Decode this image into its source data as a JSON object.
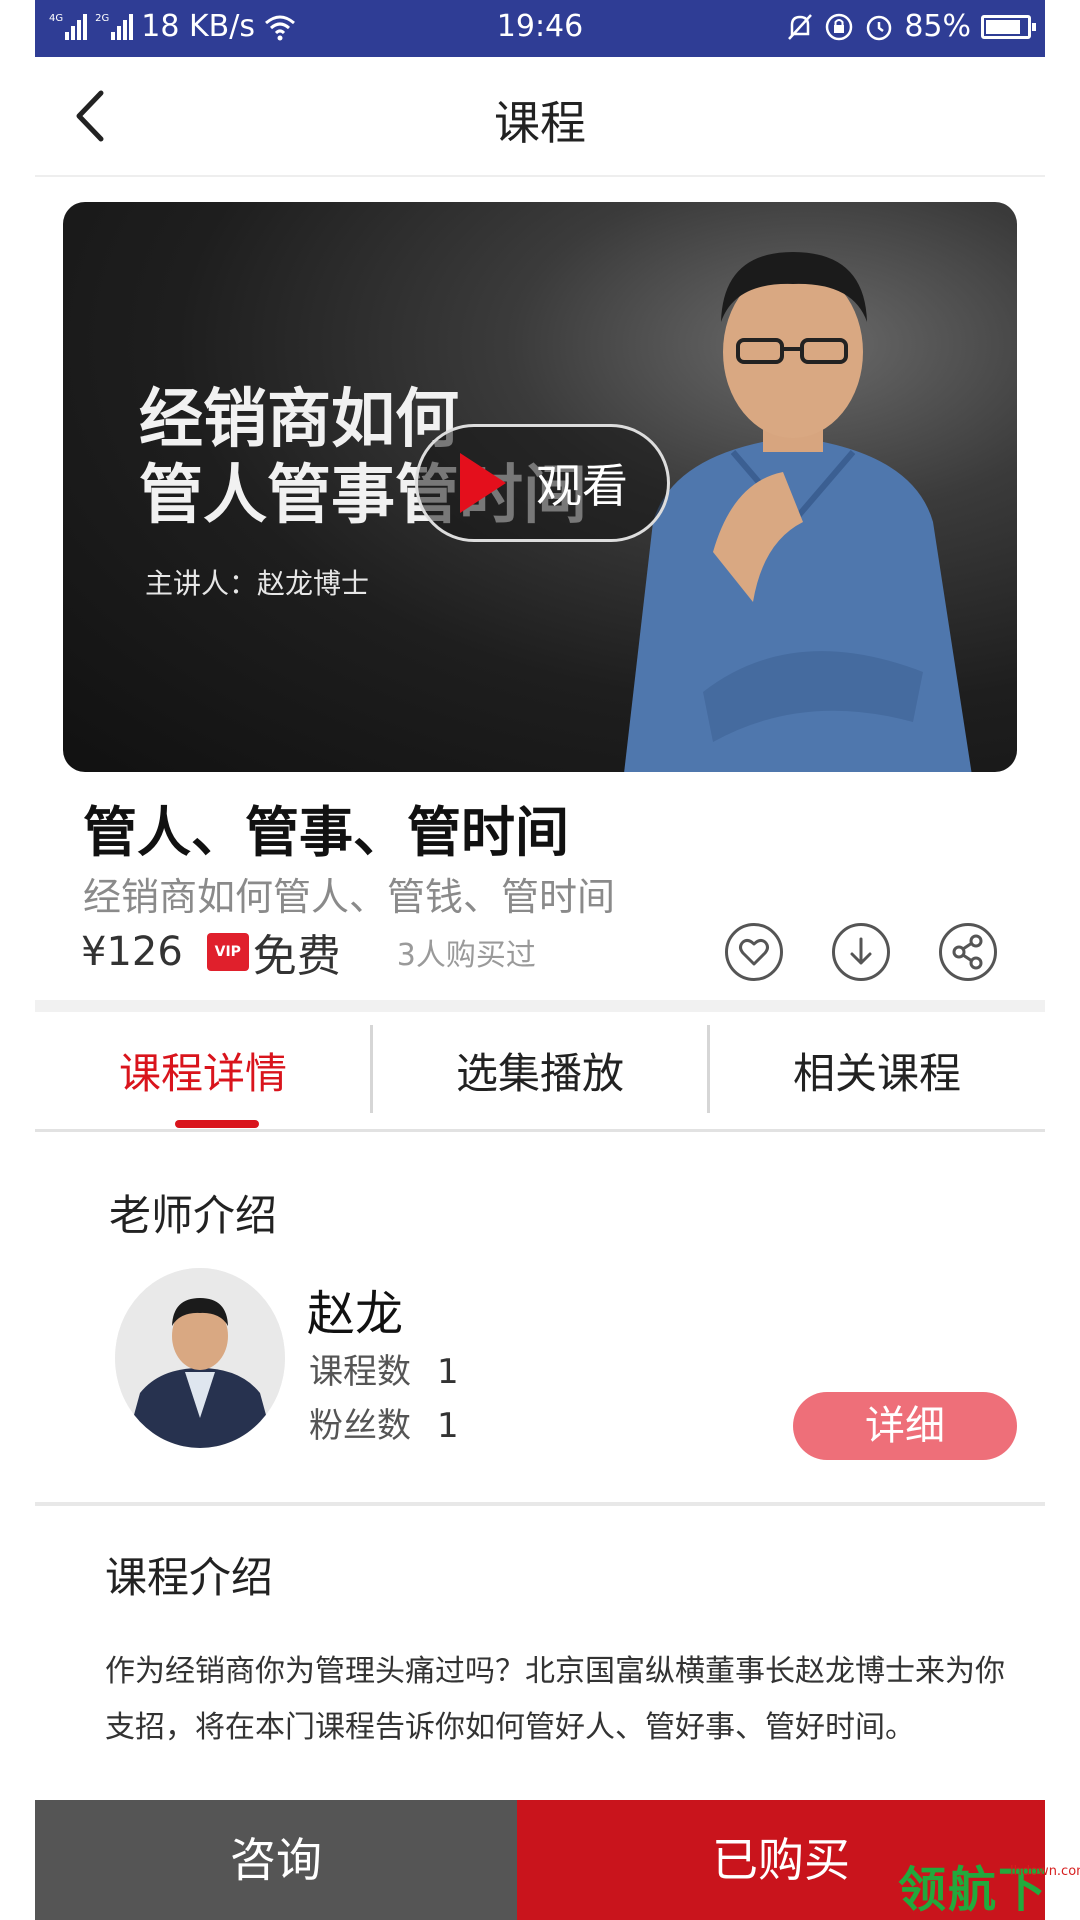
{
  "status_bar": {
    "network_speed": "18 KB/s",
    "time": "19:46",
    "battery": "85%",
    "battery_level": 0.85,
    "icons": [
      "signal-4g-icon",
      "signal-2g-icon",
      "wifi-icon",
      "mute-icon",
      "rotation-lock-icon",
      "alarm-icon",
      "battery-icon"
    ]
  },
  "header": {
    "title": "课程"
  },
  "hero": {
    "title_lines": [
      "经销商如何",
      "管人管事管时间"
    ],
    "speaker": "主讲人：赵龙博士",
    "watch_label": "观看"
  },
  "course": {
    "title": "管人、管事、管时间",
    "subtitle": "经销商如何管人、管钱、管时间",
    "price": "¥126",
    "vip_badge": "VIP",
    "vip_price": "免费",
    "buyers": "3人购买过"
  },
  "tabs": [
    {
      "label": "课程详情",
      "active": true
    },
    {
      "label": "选集播放",
      "active": false
    },
    {
      "label": "相关课程",
      "active": false
    }
  ],
  "teacher": {
    "heading": "老师介绍",
    "name": "赵龙",
    "courses_label": "课程数",
    "courses_value": "1",
    "fans_label": "粉丝数",
    "fans_value": "1",
    "detail_button": "详细"
  },
  "intro": {
    "heading": "课程介绍",
    "text": "作为经销商你为管理头痛过吗？北京国富纵横董事长赵龙博士来为你支招，将在本门课程告诉你如何管好人、管好事、管好时间。"
  },
  "bottom_bar": {
    "consult": "咨询",
    "bought": "已购买"
  },
  "watermark": {
    "brand": "领航下载",
    "site": "lhdown.com"
  },
  "colors": {
    "accent": "#d9141c",
    "status_bar": "#2f3d95",
    "detail_button": "#ee6f79",
    "consult_bg": "#555555",
    "bought_bg": "#c9141c"
  }
}
